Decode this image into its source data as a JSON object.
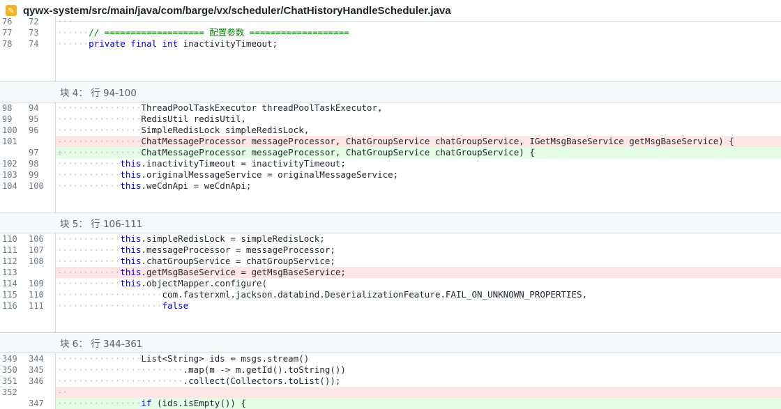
{
  "header": {
    "icon": "pencil-icon",
    "file_path": "qywx-system/src/main/java/com/barge/vx/scheduler/ChatHistoryHandleScheduler.java"
  },
  "colors": {
    "added_bg": "#e3fce6",
    "deleted_bg": "#ffe6e6",
    "keyword": "#0000c8",
    "comment": "#008000",
    "hunk_bg": "#f6f8fa"
  },
  "blocks": [
    {
      "hunk": "",
      "spacer_after": 46,
      "lines": [
        {
          "type": "ctx",
          "old": "76",
          "new": "72",
          "ws": "···",
          "tokens": []
        },
        {
          "type": "ctx",
          "old": "77",
          "new": "73",
          "ws": "······",
          "tokens": [
            {
              "t": "// =================== 配置参数 ===================",
              "c": "cm"
            }
          ]
        },
        {
          "type": "ctx",
          "old": "78",
          "new": "74",
          "ws": "······",
          "tokens": [
            {
              "t": "private final int",
              "c": "kw"
            },
            {
              "t": " inactivityTimeout;",
              "c": ""
            }
          ]
        }
      ]
    },
    {
      "hunk": "块 4： 行 94-100",
      "spacer_after": 30,
      "lines": [
        {
          "type": "ctx",
          "old": "98",
          "new": "94",
          "ws": "················",
          "tokens": [
            {
              "t": "ThreadPoolTaskExecutor threadPoolTaskExecutor,",
              "c": ""
            }
          ]
        },
        {
          "type": "ctx",
          "old": "99",
          "new": "95",
          "ws": "················",
          "tokens": [
            {
              "t": "RedisUtil redisUtil,",
              "c": ""
            }
          ]
        },
        {
          "type": "ctx",
          "old": "100",
          "new": "96",
          "ws": "················",
          "tokens": [
            {
              "t": "SimpleRedisLock simpleRedisLock,",
              "c": ""
            }
          ]
        },
        {
          "type": "del",
          "old": "101",
          "new": "",
          "ws": "-···············",
          "tokens": [
            {
              "t": "ChatMessageProcessor messageProcessor, ChatGroupService chatGroupService, IGetMsgBaseService getMsgBaseService) {",
              "c": ""
            }
          ]
        },
        {
          "type": "add",
          "old": "",
          "new": "97",
          "ws": "+···············",
          "tokens": [
            {
              "t": "ChatMessageProcessor messageProcessor, ChatGroupService chatGroupService) {",
              "c": ""
            }
          ]
        },
        {
          "type": "ctx",
          "old": "102",
          "new": "98",
          "ws": "············",
          "tokens": [
            {
              "t": "this",
              "c": "kw"
            },
            {
              "t": ".inactivityTimeout = inactivityTimeout;",
              "c": ""
            }
          ]
        },
        {
          "type": "ctx",
          "old": "103",
          "new": "99",
          "ws": "············",
          "tokens": [
            {
              "t": "this",
              "c": "kw"
            },
            {
              "t": ".originalMessageService = originalMessageService;",
              "c": ""
            }
          ]
        },
        {
          "type": "ctx",
          "old": "104",
          "new": "100",
          "ws": "············",
          "tokens": [
            {
              "t": "this",
              "c": "kw"
            },
            {
              "t": ".weCdnApi = weCdnApi;",
              "c": ""
            }
          ]
        }
      ]
    },
    {
      "hunk": "块 5： 行 106-111",
      "spacer_after": 30,
      "lines": [
        {
          "type": "ctx",
          "old": "110",
          "new": "106",
          "ws": "············",
          "tokens": [
            {
              "t": "this",
              "c": "kw"
            },
            {
              "t": ".simpleRedisLock = simpleRedisLock;",
              "c": ""
            }
          ]
        },
        {
          "type": "ctx",
          "old": "111",
          "new": "107",
          "ws": "············",
          "tokens": [
            {
              "t": "this",
              "c": "kw"
            },
            {
              "t": ".messageProcessor = messageProcessor;",
              "c": ""
            }
          ]
        },
        {
          "type": "ctx",
          "old": "112",
          "new": "108",
          "ws": "············",
          "tokens": [
            {
              "t": "this",
              "c": "kw"
            },
            {
              "t": ".chatGroupService = chatGroupService;",
              "c": ""
            }
          ]
        },
        {
          "type": "del",
          "old": "113",
          "new": "",
          "ws": "-···········",
          "tokens": [
            {
              "t": "this",
              "c": "kw"
            },
            {
              "t": ".getMsgBaseService = getMsgBaseService;",
              "c": ""
            }
          ]
        },
        {
          "type": "ctx",
          "old": "114",
          "new": "109",
          "ws": "············",
          "tokens": [
            {
              "t": "this",
              "c": "kw"
            },
            {
              "t": ".objectMapper.configure(",
              "c": ""
            }
          ]
        },
        {
          "type": "ctx",
          "old": "115",
          "new": "110",
          "ws": "····················",
          "tokens": [
            {
              "t": "com.fasterxml.jackson.databind.DeserializationFeature.FAIL_ON_UNKNOWN_PROPERTIES,",
              "c": ""
            }
          ]
        },
        {
          "type": "ctx",
          "old": "116",
          "new": "111",
          "ws": "····················",
          "tokens": [
            {
              "t": "false",
              "c": "kw"
            }
          ]
        }
      ]
    },
    {
      "hunk": "块 6： 行 344-361",
      "spacer_after": 0,
      "lines": [
        {
          "type": "ctx",
          "old": "349",
          "new": "344",
          "ws": "················",
          "tokens": [
            {
              "t": "List<String> ids = msgs.stream()",
              "c": ""
            }
          ]
        },
        {
          "type": "ctx",
          "old": "350",
          "new": "345",
          "ws": "························",
          "tokens": [
            {
              "t": ".map(m -> m.getId().toString())",
              "c": ""
            }
          ]
        },
        {
          "type": "ctx",
          "old": "351",
          "new": "346",
          "ws": "························",
          "tokens": [
            {
              "t": ".collect(Collectors.toList());",
              "c": ""
            }
          ]
        },
        {
          "type": "del",
          "old": "352",
          "new": "",
          "ws": "-·",
          "tokens": []
        },
        {
          "type": "add",
          "old": "",
          "new": "347",
          "ws": "················",
          "tokens": [
            {
              "t": "if",
              "c": "kw"
            },
            {
              "t": " (ids.isEmpty()) {",
              "c": ""
            }
          ]
        }
      ]
    }
  ]
}
